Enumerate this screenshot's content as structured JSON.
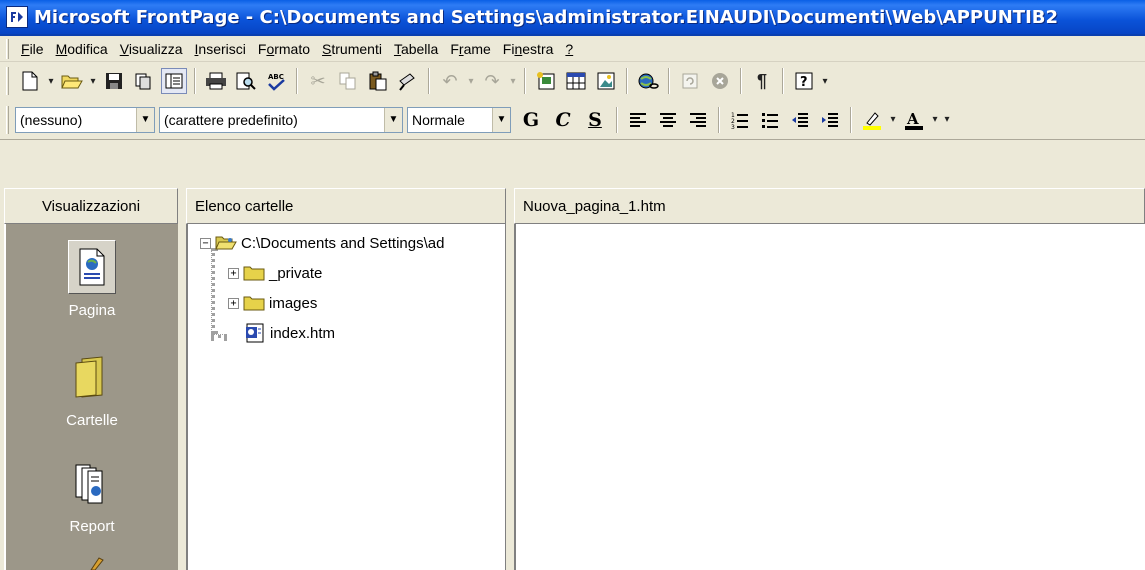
{
  "window": {
    "title": "Microsoft FrontPage - C:\\Documents and Settings\\administrator.EINAUDI\\Documenti\\Web\\APPUNTIB2"
  },
  "menu": [
    {
      "label": "File",
      "key": "F"
    },
    {
      "label": "Modifica",
      "key": "M"
    },
    {
      "label": "Visualizza",
      "key": "V"
    },
    {
      "label": "Inserisci",
      "key": "I"
    },
    {
      "label": "Formato",
      "key": "o"
    },
    {
      "label": "Strumenti",
      "key": "S"
    },
    {
      "label": "Tabella",
      "key": "T"
    },
    {
      "label": "Frame",
      "key": "r"
    },
    {
      "label": "Finestra",
      "key": "n"
    },
    {
      "label": "?",
      "key": "?"
    }
  ],
  "format_toolbar": {
    "style_value": "(nessuno)",
    "font_value": "(carattere predefinito)",
    "size_value": "Normale",
    "bold_label": "G",
    "italic_label": "C",
    "underline_label": "S",
    "paragraph_mark": "¶"
  },
  "views_panel": {
    "header": "Visualizzazioni",
    "items": [
      {
        "label": "Pagina",
        "active": true
      },
      {
        "label": "Cartelle",
        "active": false
      },
      {
        "label": "Report",
        "active": false
      }
    ]
  },
  "folder_panel": {
    "header": "Elenco cartelle",
    "root": "C:\\Documents and Settings\\ad",
    "children": [
      {
        "label": "_private",
        "type": "folder"
      },
      {
        "label": "images",
        "type": "folder"
      },
      {
        "label": "index.htm",
        "type": "file"
      }
    ]
  },
  "page_panel": {
    "header": "Nuova_pagina_1.htm"
  },
  "colors": {
    "titlebar": "#0a52d8",
    "chrome": "#ece9d8",
    "views_bg": "#9c9789",
    "folder_yellow": "#e6d24a"
  }
}
